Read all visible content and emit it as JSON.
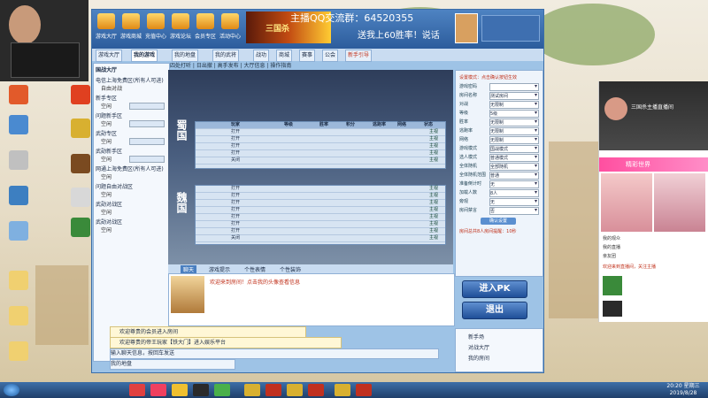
{
  "window": {
    "top_title": "主播QQ交流群：64520355",
    "banner_text": "送我上60胜率！说话",
    "banner_game": "三国杀"
  },
  "toolbar": {
    "items": [
      {
        "label": "游戏大厅",
        "icon": "lobby-icon"
      },
      {
        "label": "游戏商城",
        "icon": "shop-icon"
      },
      {
        "label": "充值中心",
        "icon": "recharge-icon"
      },
      {
        "label": "游戏论坛",
        "icon": "forum-icon"
      },
      {
        "label": "会员专区",
        "icon": "vip-icon"
      },
      {
        "label": "活动中心",
        "icon": "event-icon"
      }
    ]
  },
  "tabs": [
    "游戏大厅",
    "我的游戏",
    "我的地盘",
    "我的武将",
    "战功",
    "商城",
    "赛事",
    "公会",
    "新手引导"
  ],
  "subtabs": "四处打听 | 日出撤 | 高手发布 | 大厅信息 | 操作指南",
  "roomlist": {
    "header": "国战大厅",
    "items": [
      {
        "title": "电信上海免费区(所有人可进)",
        "sub": "自由对战"
      },
      {
        "title": "新手专区",
        "sub": "空闲"
      },
      {
        "title": "问题新手区",
        "sub": "空闲"
      },
      {
        "title": "武勋专区",
        "sub": "空闲"
      },
      {
        "title": "武勋新手区",
        "sub": "空闲"
      },
      {
        "title": "网通上海免费区(所有人可进)",
        "sub": "空闲"
      },
      {
        "title": "问题自由对战区",
        "sub": "空闲"
      },
      {
        "title": "武勋对战区",
        "sub": "空闲"
      },
      {
        "title": "武勋对战区",
        "sub": "空闲"
      }
    ]
  },
  "battle": {
    "kingdom_top": "蜀国",
    "kingdom_bottom": "魏国",
    "header": {
      "seat": "玩家",
      "level": "等级",
      "wins": "胜率",
      "score": "积分",
      "flee": "逃跑率",
      "network": "网络",
      "status": "状态"
    },
    "top_rows": [
      "打开",
      "打开",
      "打开",
      "打开",
      "关闭"
    ],
    "bottom_rows": [
      "打开",
      "打开",
      "打开",
      "打开",
      "打开",
      "打开",
      "打开",
      "关闭"
    ],
    "action": "主视"
  },
  "chat": {
    "tabs": [
      "聊天",
      "游戏提示",
      "个性表情",
      "个性装饰"
    ],
    "line": "欢迎来到房间！点击我的头像查看信息"
  },
  "notices": [
    "欢迎尊贵的会员进入房间",
    "欢迎尊贵的帝王玩家【铁大门】进入娱乐平台"
  ],
  "inputbar": {
    "placeholder": "输入聊天信息，按回车发送"
  },
  "pathbar": "我的地盘",
  "settings": {
    "title": "设置模式：点击确认按钮生效",
    "rows": [
      {
        "label": "游戏密码",
        "value": ""
      },
      {
        "label": "房间名称",
        "value": "测试房间"
      },
      {
        "label": "对战",
        "value": "无限制"
      },
      {
        "label": "等级",
        "value": "5级"
      },
      {
        "label": "胜率",
        "value": "无限制"
      },
      {
        "label": "逃跑率",
        "value": "无限制"
      },
      {
        "label": "网络",
        "value": "无限制"
      },
      {
        "label": "游戏模式",
        "value": "国战模式"
      },
      {
        "label": "选人模式",
        "value": "普通模式"
      },
      {
        "label": "全体随机",
        "value": "全部随机"
      },
      {
        "label": "全体随机范围",
        "value": "普通"
      },
      {
        "label": "准备倒计时",
        "value": "无"
      },
      {
        "label": "加载人数",
        "value": "8人"
      },
      {
        "label": "旁观",
        "value": "无"
      },
      {
        "label": "房间禁言",
        "value": "否"
      }
    ],
    "confirm": "确认设置",
    "hint": "房间总共8人房间提醒：10秒"
  },
  "buttons": {
    "join": "进入PK",
    "exit": "退出"
  },
  "side_list": {
    "items": [
      "新手场",
      "对战大厅",
      "我的房间"
    ]
  },
  "phone": {
    "title": "三国杀主播直播间",
    "banner": "精彩世界",
    "lines": [
      "我的观众",
      "我的直播",
      "亲友团",
      "欢迎来到直播间，关注主播"
    ]
  },
  "taskbar": {
    "clock_time": "20:20 星期三",
    "clock_date": "2019/8/28",
    "icons": [
      "start-icon",
      "browser-icon",
      "music-icon",
      "folder-icon",
      "qq-icon",
      "chat-icon",
      "game-icon",
      "game-icon",
      "game-icon",
      "game-icon",
      "game-icon",
      "game-icon"
    ]
  }
}
